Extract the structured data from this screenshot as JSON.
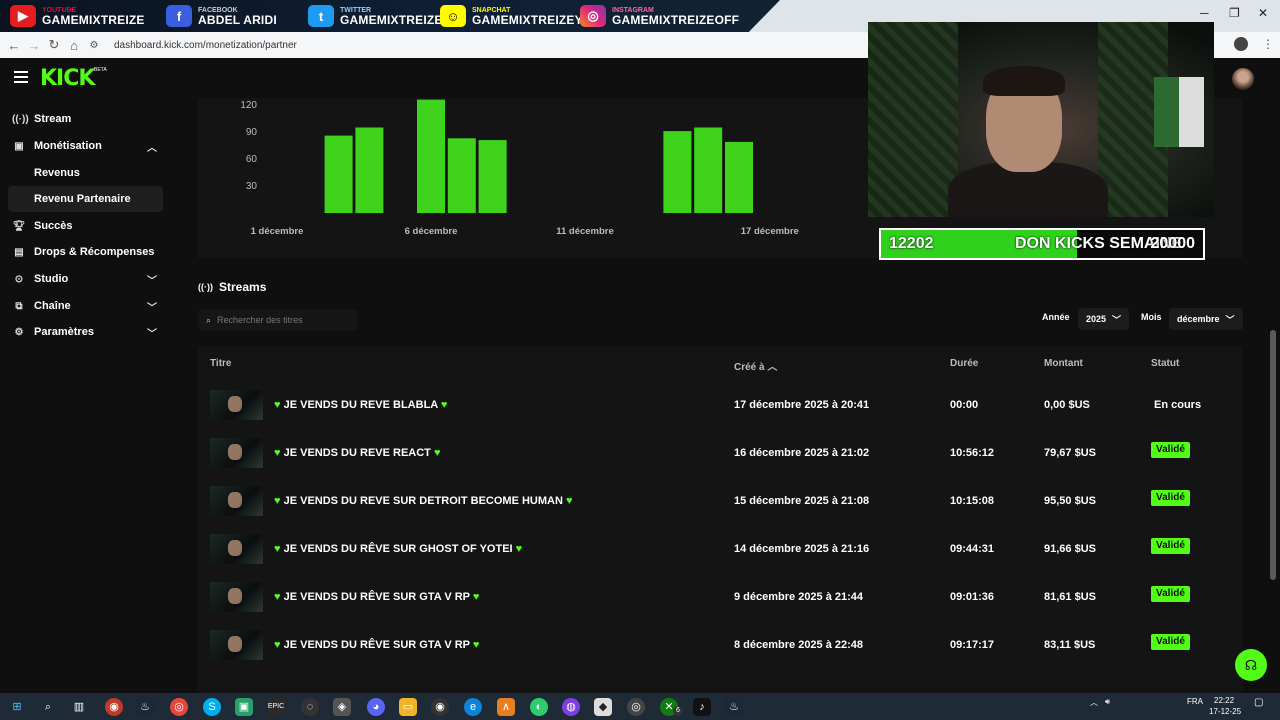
{
  "banner": {
    "youtube": {
      "small": "YOUTUBE",
      "name": "GAMEMIXTREIZE"
    },
    "facebook": {
      "small": "FACEBOOK",
      "name": "ABDEL ARIDI"
    },
    "twitter": {
      "small": "TWITTER",
      "name": "GAMEMIXTREIZE"
    },
    "snapchat": {
      "small": "SNAPCHAT",
      "name": "GAMEMIXTREIZEYT"
    },
    "instagram": {
      "small": "INSTAGRAM",
      "name": "GAMEMIXTREIZEOFF"
    }
  },
  "browser": {
    "url": "dashboard.kick.com/monetization/partner"
  },
  "header": {
    "logo": "KICK",
    "beta": "BETA"
  },
  "sidebar": {
    "items": [
      {
        "label": "Stream",
        "icon": "broadcast-icon"
      },
      {
        "label": "Monétisation",
        "icon": "monetization-icon"
      },
      {
        "label": "Revenus"
      },
      {
        "label": "Revenu Partenaire"
      },
      {
        "label": "Succès",
        "icon": "trophy-icon"
      },
      {
        "label": "Drops & Récompenses",
        "icon": "gift-icon"
      },
      {
        "label": "Studio",
        "icon": "studio-icon"
      },
      {
        "label": "Chaîne",
        "icon": "channel-icon"
      },
      {
        "label": "Paramètres",
        "icon": "gear-icon"
      }
    ]
  },
  "chart_data": {
    "type": "bar",
    "y_ticks": [
      120,
      90,
      60,
      30
    ],
    "x_ticks": [
      "1 décembre",
      "6 décembre",
      "11 décembre",
      "17 décembre"
    ],
    "bars": [
      {
        "day": 3,
        "value": 86
      },
      {
        "day": 4,
        "value": 95
      },
      {
        "day": 6,
        "value": 126
      },
      {
        "day": 7,
        "value": 83
      },
      {
        "day": 8,
        "value": 81
      },
      {
        "day": 14,
        "value": 91
      },
      {
        "day": 15,
        "value": 95
      },
      {
        "day": 16,
        "value": 79
      }
    ],
    "color": "#3fd41b"
  },
  "streams": {
    "title": "Streams",
    "search_placeholder": "Rechercher des titres",
    "year_label": "Année",
    "year_value": "2025",
    "month_label": "Mois",
    "month_value": "décembre",
    "columns": {
      "title": "Titre",
      "created": "Créé à",
      "duration": "Durée",
      "amount": "Montant",
      "status": "Statut"
    },
    "rows": [
      {
        "title": "JE VENDS DU REVE BLABLA",
        "created": "17 décembre 2025 à 20:41",
        "duration": "00:00",
        "amount": "0,00 $US",
        "status": "En cours",
        "validated": false
      },
      {
        "title": "JE VENDS DU REVE REACT",
        "created": "16 décembre 2025 à 21:02",
        "duration": "10:56:12",
        "amount": "79,67 $US",
        "status": "Validé",
        "validated": true
      },
      {
        "title": "JE VENDS DU REVE SUR DETROIT BECOME HUMAN",
        "created": "15 décembre 2025 à 21:08",
        "duration": "10:15:08",
        "amount": "95,50 $US",
        "status": "Validé",
        "validated": true
      },
      {
        "title": "JE VENDS DU RÊVE SUR GHOST OF YOTEI",
        "created": "14 décembre 2025 à 21:16",
        "duration": "09:44:31",
        "amount": "91,66 $US",
        "status": "Validé",
        "validated": true
      },
      {
        "title": "JE VENDS DU RÊVE SUR GTA V RP",
        "created": "9 décembre 2025 à 21:44",
        "duration": "09:01:36",
        "amount": "81,61 $US",
        "status": "Validé",
        "validated": true
      },
      {
        "title": "JE VENDS DU RÊVE SUR GTA V RP",
        "created": "8 décembre 2025 à 22:48",
        "duration": "09:17:17",
        "amount": "83,11 $US",
        "status": "Validé",
        "validated": true
      }
    ]
  },
  "overlay": {
    "goal_current": "12202",
    "goal_text": "DON KICKS SEMAINE",
    "goal_target": "20000",
    "goal_progress": 0.61
  },
  "taskbar": {
    "lang": "FRA",
    "time": "22:22",
    "date": "17-12-25",
    "steam_badge": "6"
  }
}
